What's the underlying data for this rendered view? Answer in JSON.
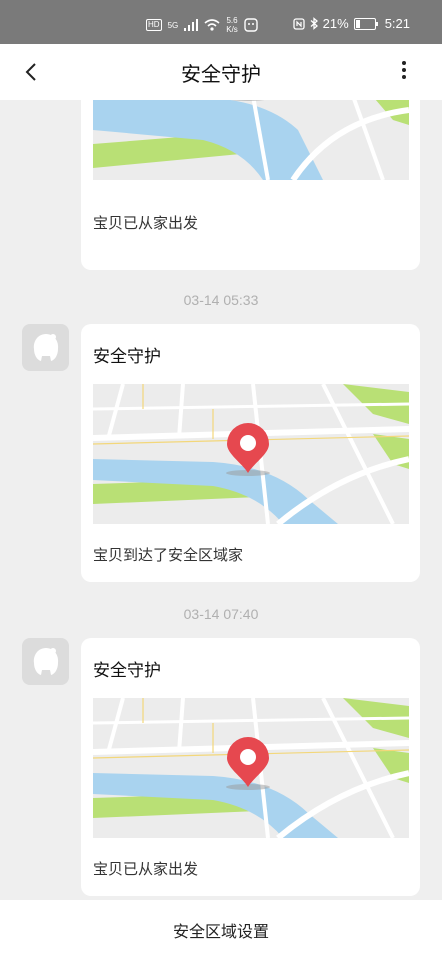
{
  "status_bar": {
    "hd": "HD",
    "network": "5G",
    "speed_value": "5.6",
    "speed_unit": "K/s",
    "battery": "21%",
    "battery_level": 0.21,
    "time": "5:21"
  },
  "header": {
    "title": "安全守护"
  },
  "feed": {
    "items": [
      {
        "title": "安全守护",
        "caption": "宝贝已从家出发"
      },
      {
        "timestamp": "03-14 05:33",
        "title": "安全守护",
        "caption": "宝贝到达了安全区域家"
      },
      {
        "timestamp": "03-14 07:40",
        "title": "安全守护",
        "caption": "宝贝已从家出发"
      }
    ]
  },
  "footer": {
    "settings_label": "安全区域设置"
  },
  "colors": {
    "status_bar_bg": "#7a7a7a",
    "page_bg": "#efefef",
    "map_pin": "#e6484f",
    "map_river": "#a9d3ef",
    "map_park": "#b9e075",
    "timestamp_text": "#b0b0b0"
  },
  "icons": {
    "back": "chevron-left-icon",
    "more": "more-vertical-icon",
    "pin": "map-pin-icon",
    "avatar": "robot-avatar-icon"
  }
}
